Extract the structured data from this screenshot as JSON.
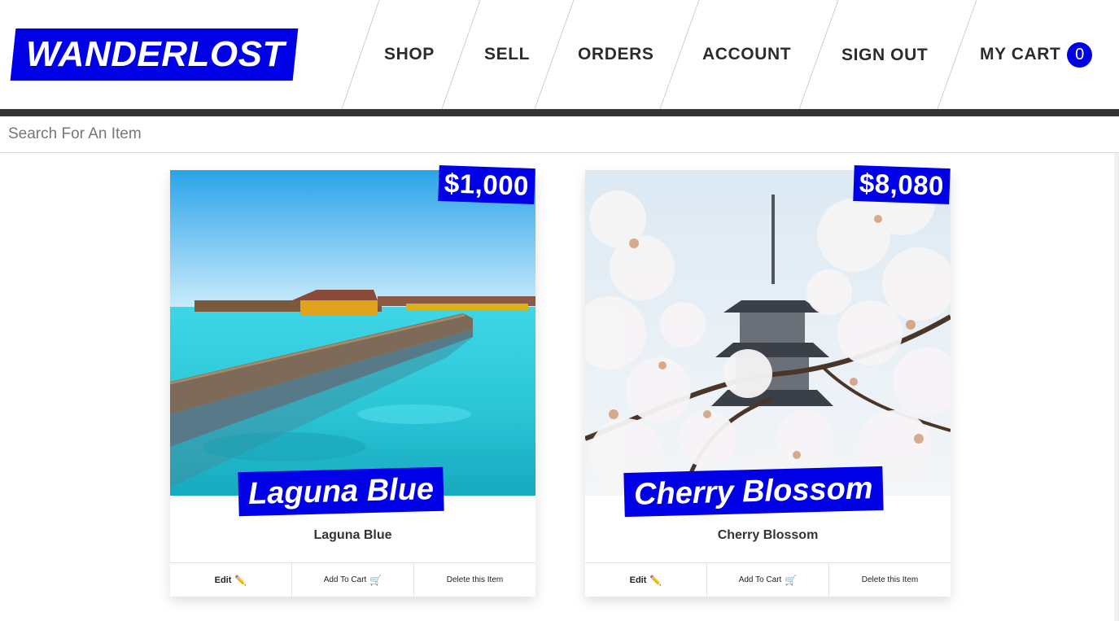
{
  "brand": {
    "logo_text": "WANDERLOST"
  },
  "nav": {
    "shop": "SHOP",
    "sell": "SELL",
    "orders": "ORDERS",
    "account": "ACCOUNT",
    "sign_out": "SIGN OUT",
    "cart_label": "MY CART",
    "cart_count": "0"
  },
  "search": {
    "placeholder": "Search For An Item",
    "value": ""
  },
  "items": [
    {
      "price": "$1,000",
      "banner": "Laguna Blue",
      "title": "Laguna Blue",
      "edit_label": "Edit",
      "add_label": "Add To Cart",
      "delete_label": "Delete this Item",
      "image": "tropical lagoon with wooden pier and water villas"
    },
    {
      "price": "$8,080",
      "banner": "Cherry Blossom",
      "title": "Cherry Blossom",
      "edit_label": "Edit",
      "add_label": "Add To Cart",
      "delete_label": "Delete this Item",
      "image": "cherry blossoms framing a pagoda"
    }
  ],
  "icons": {
    "edit": "pencil-icon",
    "add_to_cart": "cart-icon"
  },
  "colors": {
    "accent": "#0000e6",
    "dark_bar": "#333333",
    "nav_text": "#2c2c2c"
  }
}
